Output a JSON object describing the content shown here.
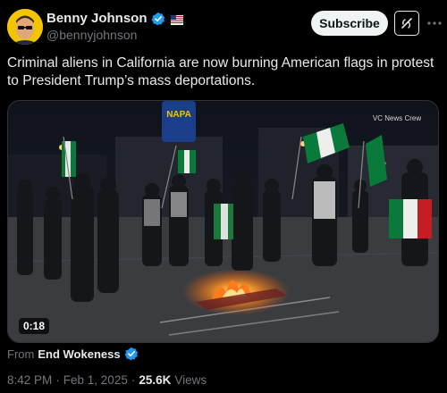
{
  "author": {
    "display_name": "Benny Johnson",
    "handle": "@bennyjohnson"
  },
  "actions": {
    "subscribe_label": "Subscribe"
  },
  "post": {
    "text": "Criminal aliens in California are now burning American flags in protest to President Trump’s mass deportations."
  },
  "media": {
    "watermark": "VC News Crew",
    "duration": "0:18",
    "sign_text": "NAPA"
  },
  "attribution": {
    "prefix": "From",
    "source_name": "End Wokeness"
  },
  "meta": {
    "time": "8:42 PM",
    "separator": "·",
    "date": "Feb 1, 2025",
    "views_count": "25.6K",
    "views_label": "Views"
  },
  "colors": {
    "background": "#000000",
    "text": "#e7e9ea",
    "secondary_text": "#71767b",
    "verified_blue": "#1d9bf0",
    "fire": "#ff7a1a"
  },
  "icons": {
    "verified": "verified-badge-icon",
    "affiliation": "affiliation-flag-icon",
    "grok": "grok-icon",
    "more": "more-options-icon"
  }
}
